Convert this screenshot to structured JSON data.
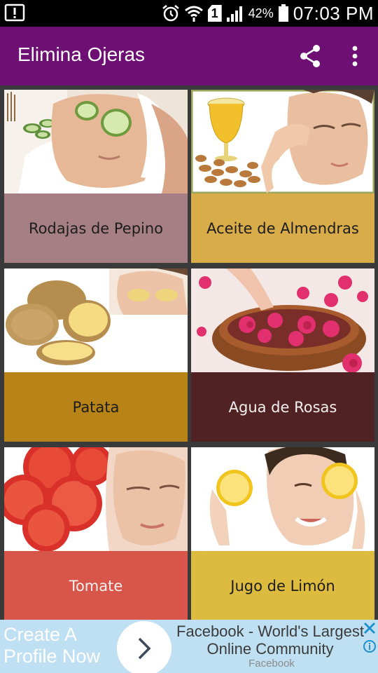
{
  "status_bar": {
    "battery_percent": "42%",
    "time": "07:03 PM",
    "sim_slot": "1",
    "icons": [
      "notification-alert-icon",
      "alarm-icon",
      "wifi-icon",
      "sim-icon",
      "signal-icon",
      "battery-icon"
    ]
  },
  "app_bar": {
    "title": "Elimina Ojeras",
    "background": "#6e0f74",
    "actions": [
      "share-icon",
      "more-vert-icon"
    ]
  },
  "cards": [
    {
      "label": "Rodajas de Pepino",
      "color": "#a67f84",
      "image": "cucumber-eyes-photo"
    },
    {
      "label": "Aceite de Almendras",
      "color": "#d9ac4a",
      "image": "almond-oil-photo"
    },
    {
      "label": "Patata",
      "color": "#b88317",
      "image": "potato-photo"
    },
    {
      "label": "Agua de Rosas",
      "color": "#512223",
      "image": "rose-water-photo"
    },
    {
      "label": "Tomate",
      "color": "#d8554a",
      "image": "tomato-photo"
    },
    {
      "label": "Jugo de Limón",
      "color": "#dcbb3e",
      "image": "lemon-photo"
    }
  ],
  "ad": {
    "left_text_line1": "Create A",
    "left_text_line2": "Profile Now",
    "title": "Facebook - World's Largest Online Community",
    "source": "Facebook",
    "background": "#bfe0f2"
  }
}
